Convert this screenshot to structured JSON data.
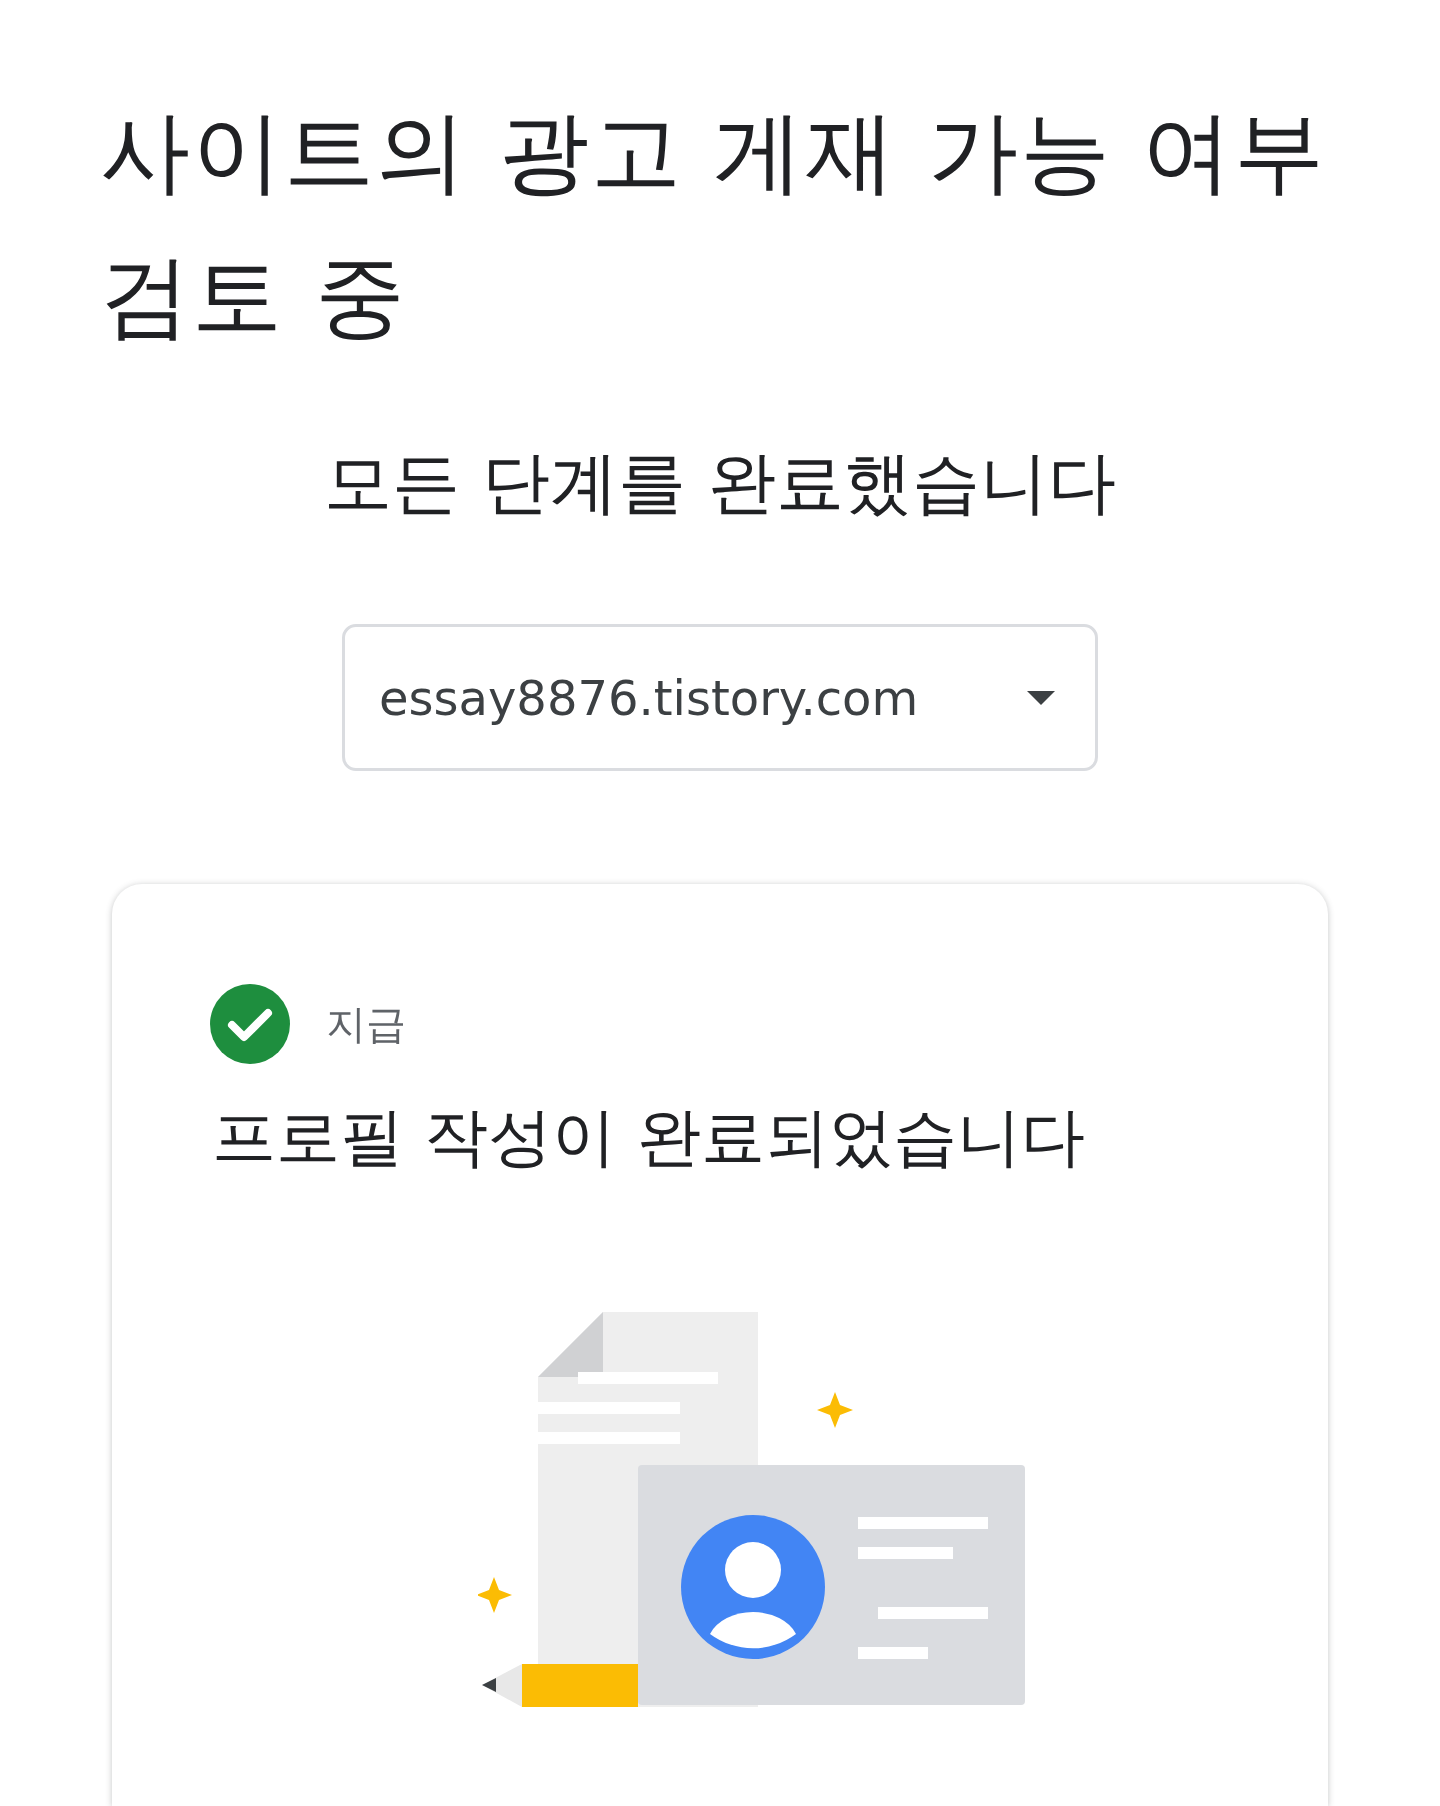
{
  "title": "사이트의 광고 게재 가능 여부 검토 중",
  "subtitle": "모든 단계를 완료했습니다",
  "site_select": {
    "value": "essay8876.tistory.com"
  },
  "step_card": {
    "status": {
      "done": true,
      "label": "지급"
    },
    "heading": "프로필 작성이 완료되었습니다"
  }
}
